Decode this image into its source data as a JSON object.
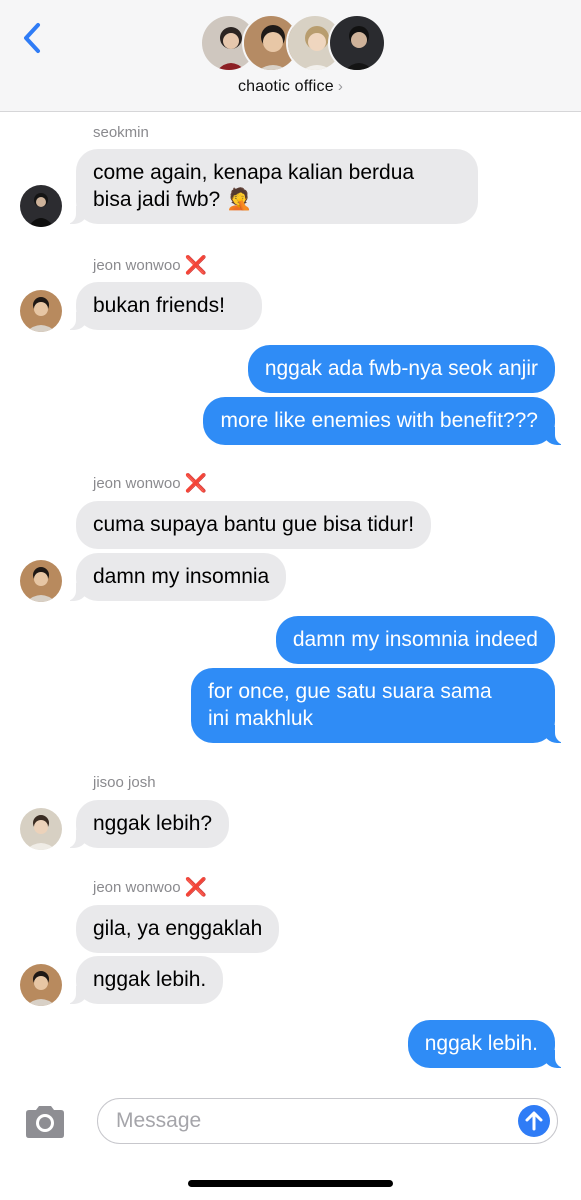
{
  "header": {
    "group_name": "chaotic office",
    "chevron": "›",
    "back_icon": "chevron-left-icon",
    "member_count": 4
  },
  "messages": [
    {
      "sender": "seokmin",
      "side": "in",
      "lines": [
        "come again, kenapa kalian berdua",
        "bisa jadi fwb? 🤦"
      ]
    },
    {
      "sender": "jeon wonwoo",
      "sender_mark": "❌",
      "side": "in",
      "lines": [
        "bukan friends!"
      ]
    },
    {
      "side": "out",
      "lines": [
        "nggak ada fwb-nya seok anjir"
      ]
    },
    {
      "side": "out",
      "lines": [
        "more like enemies with benefit???"
      ]
    },
    {
      "sender": "jeon wonwoo",
      "sender_mark": "❌",
      "side": "in",
      "lines": [
        "cuma supaya bantu gue bisa tidur!"
      ]
    },
    {
      "side": "in",
      "lines": [
        "damn my insomnia"
      ]
    },
    {
      "side": "out",
      "lines": [
        "damn my insomnia indeed"
      ]
    },
    {
      "side": "out",
      "lines": [
        "for once, gue satu suara sama",
        "ini makhluk"
      ]
    },
    {
      "sender": "jisoo josh",
      "side": "in",
      "lines": [
        "nggak lebih?"
      ]
    },
    {
      "sender": "jeon wonwoo",
      "sender_mark": "❌",
      "side": "in",
      "lines": [
        "gila, ya enggaklah"
      ]
    },
    {
      "side": "in",
      "lines": [
        "nggak lebih."
      ]
    },
    {
      "side": "out",
      "lines": [
        "nggak lebih."
      ]
    }
  ],
  "input": {
    "placeholder": "Message",
    "camera_icon": "camera-icon",
    "send_icon": "arrow-up-icon"
  },
  "colors": {
    "outgoing_bubble": "#2f8cf6",
    "incoming_bubble": "#e9e9eb",
    "accent": "#2f7cf6",
    "sender_mark": "#d93a2f"
  }
}
